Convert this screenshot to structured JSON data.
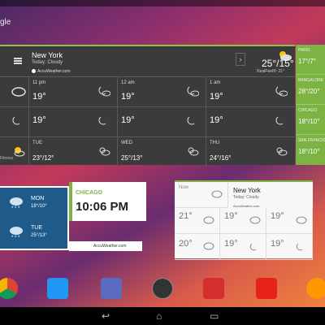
{
  "launcher": {
    "search_label": "gle"
  },
  "big_widget": {
    "city": "New York",
    "condition": "Today: Cloudy",
    "brand": "AccuWeather.com",
    "temps": "25°/15°",
    "realfeel": "RealFeel®: 21°",
    "hourly": [
      {
        "label": "11 pm",
        "temp": "19°"
      },
      {
        "label": "12 am",
        "temp": "19°"
      },
      {
        "label": "1 am",
        "temp": "19°"
      }
    ],
    "daily": [
      {
        "label": "TUE",
        "temp": "23°/12°"
      },
      {
        "label": "WED",
        "temp": "25°/13°"
      },
      {
        "label": "THU",
        "temp": "24°/16°"
      }
    ],
    "side": [
      {
        "city": "PARIS",
        "temp": "17°/7°"
      },
      {
        "city": "BANGALORE",
        "temp": "28°/20°"
      },
      {
        "city": "CHICAGO",
        "temp": "18°/10°"
      },
      {
        "city": "SAN FRANCIS",
        "temp": "18°/10°"
      }
    ],
    "footer": "Fitness"
  },
  "left_widget": {
    "days": [
      {
        "day": "MON",
        "temp": "18°/10°"
      },
      {
        "day": "TUE",
        "temp": "25°/13°"
      }
    ],
    "brand": "AccuWeather.com"
  },
  "clock_widget": {
    "city": "CHICAGO",
    "time": "10:06 PM"
  },
  "right_widget": {
    "now_label": "Now",
    "now_temp": "20°",
    "city": "New York",
    "condition": "Today: Cloudy",
    "brand": "AccuWeather.com",
    "cells": [
      {
        "label": "21°",
        "temp": "19°"
      },
      {
        "label": "20°",
        "temp": "19°"
      },
      {
        "label": "19°",
        "temp": "19°"
      }
    ],
    "bottom": [
      "20°",
      "19°",
      "19°"
    ]
  },
  "dock_apps": [
    "chrome-icon",
    "play-books-icon",
    "photos-icon",
    "app-drawer-icon",
    "play-movies-icon",
    "youtube-icon",
    "play-music-icon"
  ],
  "colors": {
    "accent": "#7cb342",
    "widget_dark": "#3b3b3b"
  }
}
